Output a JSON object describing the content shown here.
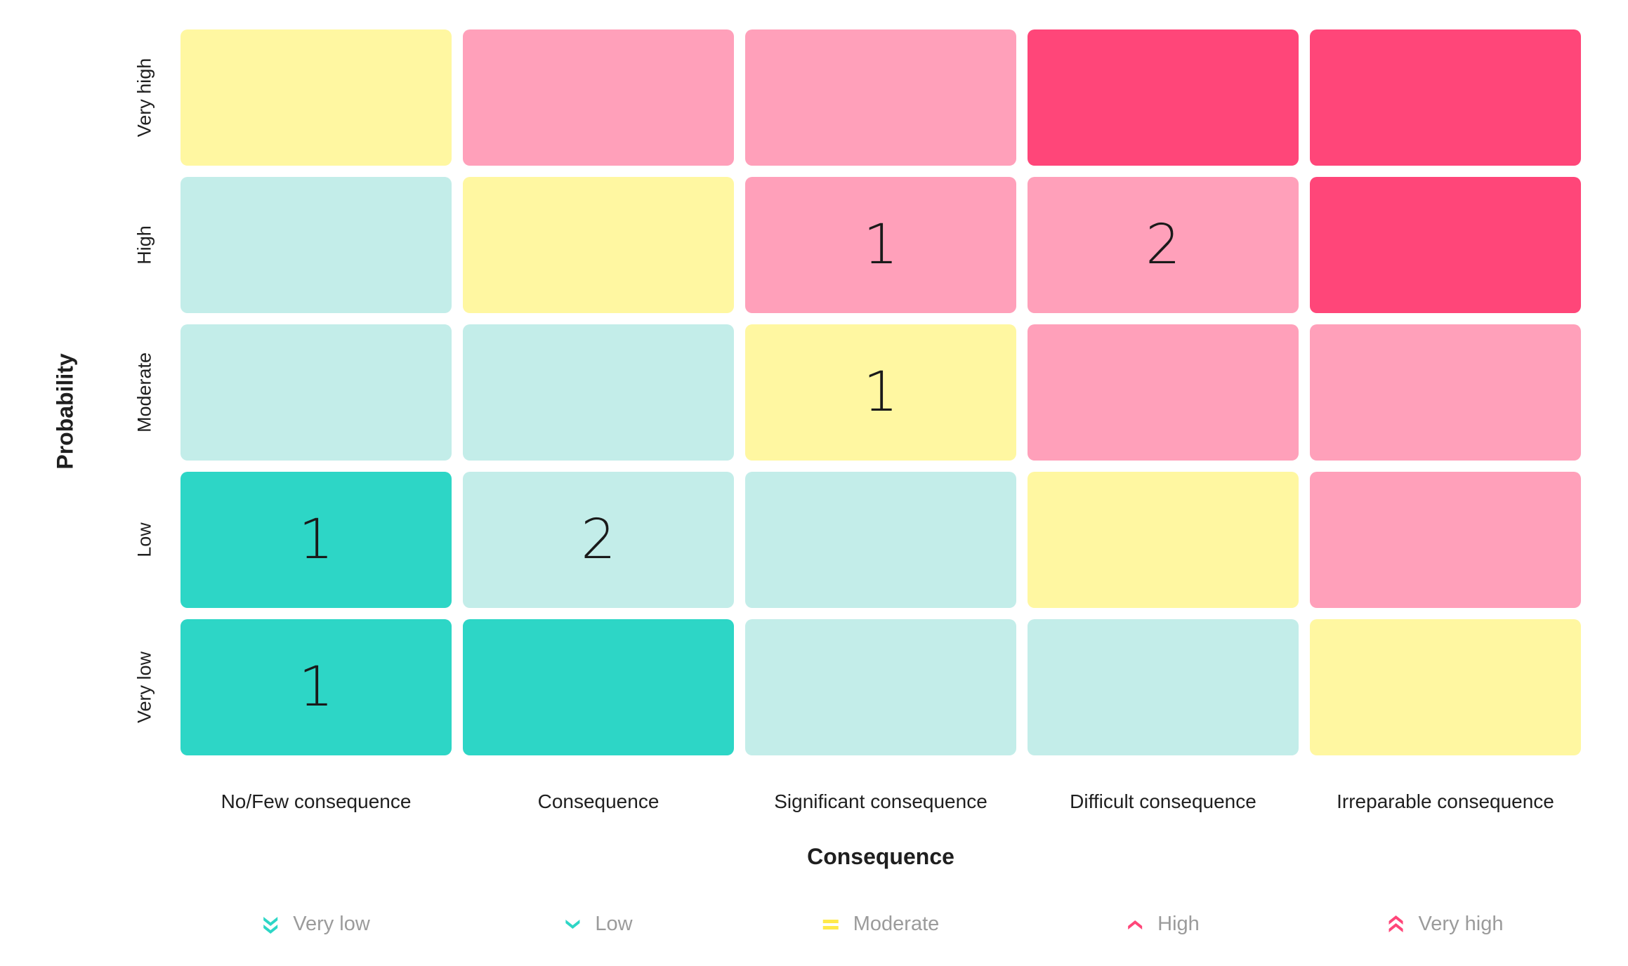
{
  "chart_data": {
    "type": "heatmap",
    "title": "",
    "xlabel": "Consequence",
    "ylabel": "Probability",
    "x_categories": [
      "No/Few consequence",
      "Consequence",
      "Significant consequence",
      "Difficult consequence",
      "Irreparable consequence"
    ],
    "y_categories_top_to_bottom": [
      "Very high",
      "High",
      "Moderate",
      "Low",
      "Very low"
    ],
    "risk_levels": [
      "Very low",
      "Low",
      "Moderate",
      "High",
      "Very high"
    ],
    "level_colors": {
      "Very low": "#2DD6C6",
      "Low": "#C3EDE9",
      "Moderate": "#FFF7A1",
      "High": "#FFA0BA",
      "Very high": "#FF4679"
    },
    "cell_levels": [
      [
        "Moderate",
        "High",
        "High",
        "Very high",
        "Very high"
      ],
      [
        "Low",
        "Moderate",
        "High",
        "High",
        "Very high"
      ],
      [
        "Low",
        "Low",
        "Moderate",
        "High",
        "High"
      ],
      [
        "Very low",
        "Low",
        "Low",
        "Moderate",
        "High"
      ],
      [
        "Very low",
        "Very low",
        "Low",
        "Low",
        "Moderate"
      ]
    ],
    "cell_counts": [
      [
        null,
        null,
        null,
        null,
        null
      ],
      [
        null,
        null,
        1,
        2,
        null
      ],
      [
        null,
        null,
        1,
        null,
        null
      ],
      [
        1,
        2,
        null,
        null,
        null
      ],
      [
        1,
        null,
        null,
        null,
        null
      ]
    ],
    "legend_position": "bottom"
  },
  "legend": [
    {
      "label": "Very low",
      "icon": "double-chevron-down-icon",
      "color": "#2DD6C6"
    },
    {
      "label": "Low",
      "icon": "chevron-down-icon",
      "color": "#2DD6C6"
    },
    {
      "label": "Moderate",
      "icon": "equals-icon",
      "color": "#FFE94A"
    },
    {
      "label": "High",
      "icon": "chevron-up-icon",
      "color": "#FF4679"
    },
    {
      "label": "Very high",
      "icon": "double-chevron-up-icon",
      "color": "#FF4679"
    }
  ]
}
